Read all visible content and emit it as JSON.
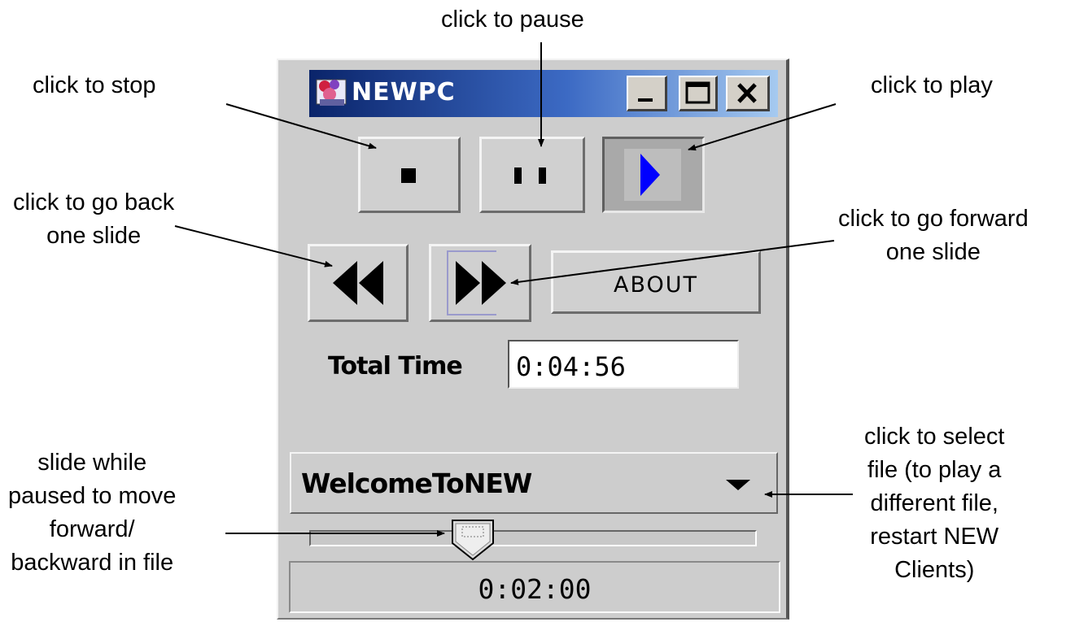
{
  "window": {
    "title": "NEWPC"
  },
  "buttons": {
    "about_label": "ABOUT"
  },
  "time": {
    "total_label": "Total Time",
    "total_value": "0:04:56",
    "current_value": "0:02:00"
  },
  "file": {
    "selected": "WelcomeToNEW"
  },
  "slider": {
    "position_fraction": 0.35
  },
  "callouts": {
    "pause": "click to pause",
    "stop": "click to stop",
    "play": "click to play",
    "back_1": "click to go back",
    "back_2": "one slide",
    "forward_1": "click to go forward",
    "forward_2": "one slide",
    "select_1": "click to select",
    "select_2": "file (to play a",
    "select_3": "different file,",
    "select_4": "restart NEW",
    "select_5": "Clients)",
    "slide_1": "slide while",
    "slide_2": "paused to move",
    "slide_3": "forward/",
    "slide_4": "backward in file"
  },
  "icons": [
    "app-icon",
    "minimize-icon",
    "maximize-icon",
    "close-icon",
    "stop-icon",
    "pause-icon",
    "play-icon",
    "rewind-icon",
    "fast-forward-icon",
    "dropdown-arrow-icon",
    "slider-thumb"
  ],
  "colors": {
    "window_bg": "#cdcdcd",
    "titlebar_start": "#0a246a",
    "titlebar_end": "#a6caf0",
    "play_icon": "#0000ff"
  }
}
